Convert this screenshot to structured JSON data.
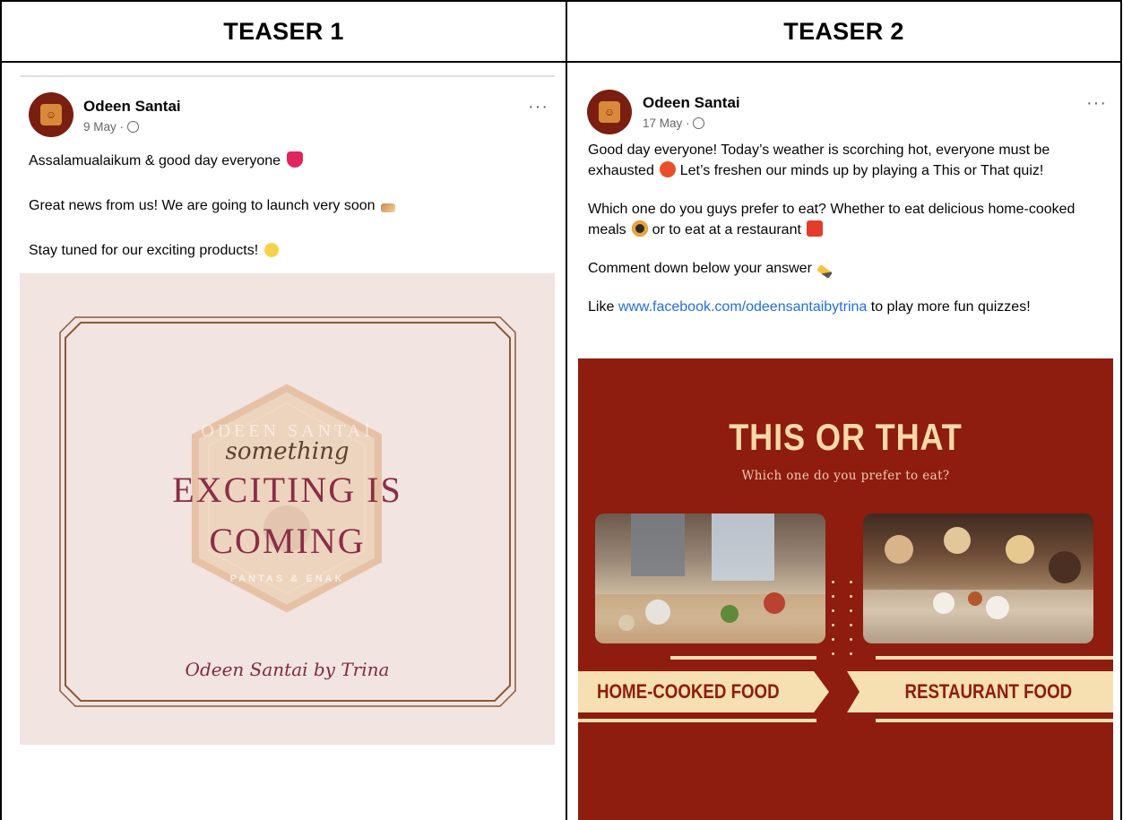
{
  "headers": {
    "teaser1": "TEASER 1",
    "teaser2": "TEASER 2"
  },
  "post1": {
    "author": "Odeen Santai",
    "date": "9 May",
    "privacy_icon": "globe-icon",
    "menu_icon": "more-options-icon",
    "menu_label": "···",
    "lines": [
      "Assalamualaikum & good day everyone",
      "Great news from us! We are going to launch very soon",
      "Stay tuned for our exciting products!"
    ],
    "image": {
      "script_text": "something",
      "line1": "EXCITING IS",
      "line2": "COMING",
      "signature": "Odeen Santai by Trina",
      "watermark_top": "ODEEN SANTAI",
      "watermark_bottom": "PANTAS & ENAK"
    },
    "colors": {
      "image_bg": "#f1e4e1",
      "accent": "#8a2e46",
      "border": "#8a5a3a"
    }
  },
  "post2": {
    "author": "Odeen Santai",
    "date": "17 May",
    "privacy_icon": "globe-icon",
    "menu_icon": "more-options-icon",
    "menu_label": "···",
    "para1": "Good day everyone! Today’s weather is scorching hot, everyone must be exhausted",
    "para1_tail": "Let’s freshen our minds up by playing a This or That quiz!",
    "para2_a": "Which one do you guys prefer to eat? Whether to eat delicious home-cooked meals",
    "para2_b": "or to eat at a restaurant",
    "para3": "Comment down below your answer",
    "para4_prefix": "Like",
    "para4_link": "www.facebook.com/odeensantaibytrina",
    "para4_suffix": "to play more fun quizzes!",
    "image": {
      "title": "THIS OR THAT",
      "subtitle": "Which one do you prefer to eat?",
      "option_left": "HOME-COOKED FOOD",
      "option_right": "RESTAURANT FOOD"
    },
    "colors": {
      "image_bg": "#8e1c0f",
      "cream": "#f6dfb1",
      "link": "#216fdb"
    }
  }
}
